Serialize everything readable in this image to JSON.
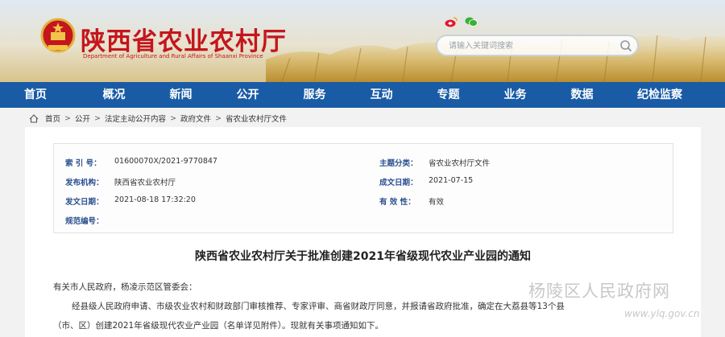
{
  "header": {
    "title": "陕西省农业农村厅",
    "subtitle": "Department of Agriculture and Rural Affairs of Shaanxi Province",
    "search_placeholder": "请输入关键词搜索"
  },
  "nav": {
    "items": [
      "首页",
      "概况",
      "新闻",
      "公开",
      "服务",
      "互动",
      "专题",
      "业务",
      "数据",
      "纪检监察"
    ]
  },
  "breadcrumb": [
    "首页",
    "公开",
    "法定主动公开内容",
    "政府文件",
    "省农业农村厅文件"
  ],
  "info": {
    "index_label": "索 引 号：",
    "index_value": "01600070X/2021-9770847",
    "topic_label": "主题分类：",
    "topic_value": "省农业农村厅文件",
    "publisher_label": "发布机构：",
    "publisher_value": "陕西省农业农村厅",
    "written_label": "成文日期：",
    "written_value": "2021-07-15",
    "published_label": "发文日期：",
    "published_value": "2021-08-18 17:32:20",
    "validity_label": "有 效 性：",
    "validity_value": "有效",
    "doc_no_label": "规范编号："
  },
  "document": {
    "title": "陕西省农业农村厅关于批准创建2021年省级现代农业产业园的通知",
    "salutation": "有关市人民政府，杨凌示范区管委会：",
    "paragraph_line1": "经县级人民政府申请、市级农业农村和财政部门审核推荐、专家评审、商省财政厅同意，并报请省政府批准，确定在大荔县等13个县",
    "paragraph_line2": "（市、区）创建2021年省级现代农业产业园（名单详见附件）。现就有关事项通知如下。"
  },
  "watermark": {
    "text": "杨陵区人民政府网",
    "url": "www.ylq.gov.cn"
  },
  "colors": {
    "brand_red": "#c4161c",
    "nav_blue": "#1a5ba5",
    "label_blue": "#2a4f8f"
  }
}
